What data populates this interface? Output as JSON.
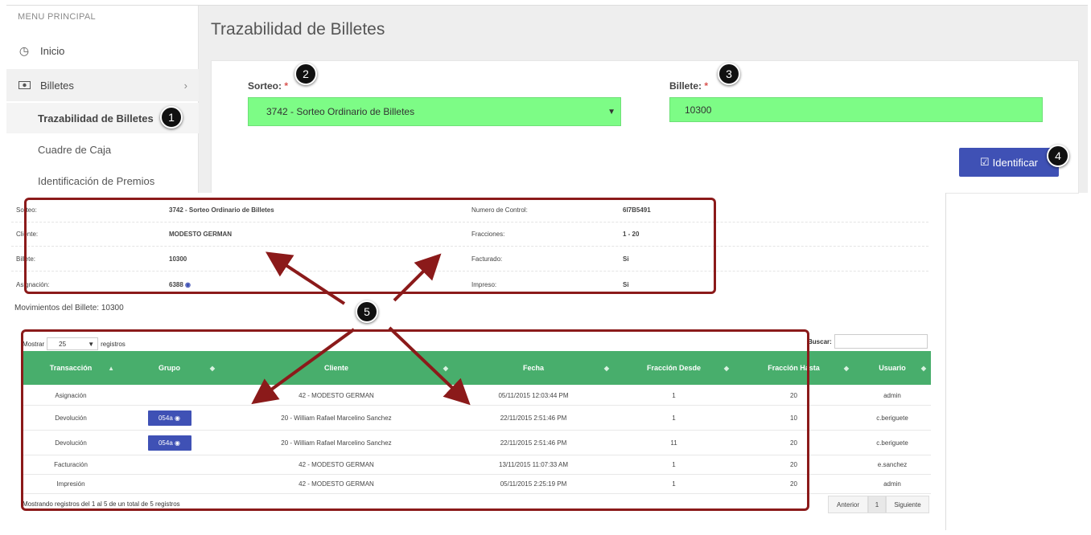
{
  "sidebar": {
    "menu_title": "MENU PRINCIPAL",
    "items": [
      {
        "label": "Inicio",
        "icon": "clock-icon"
      },
      {
        "label": "Billetes",
        "icon": "money-icon"
      }
    ],
    "subitems": [
      {
        "label": "Trazabilidad de Billetes",
        "active": true
      },
      {
        "label": "Cuadre de Caja"
      },
      {
        "label": "Identificación de Premios"
      }
    ]
  },
  "page": {
    "title": "Trazabilidad de Billetes"
  },
  "form": {
    "sorteo_label": "Sorteo:",
    "sorteo_value": "3742 - Sorteo Ordinario de Billetes",
    "billete_label": "Billete:",
    "billete_value": "10300",
    "required_mark": "*",
    "identify_button": "Identificar",
    "field_color": "#7dfc86",
    "button_color": "#3f51b5"
  },
  "callouts": [
    "1",
    "2",
    "3",
    "4",
    "5"
  ],
  "info": {
    "rows": [
      {
        "k1": "Sorteo:",
        "v1": "3742 - Sorteo Ordinario de Billetes",
        "k2": "Numero de Control:",
        "v2": "6I7B5491"
      },
      {
        "k1": "Cliente:",
        "v1": "MODESTO GERMAN",
        "k2": "Fracciones:",
        "v2": "1 - 20"
      },
      {
        "k1": "Billete:",
        "v1": "10300",
        "k2": "Facturado:",
        "v2": "Si"
      },
      {
        "k1": "Asignación:",
        "v1": "6388",
        "k2": "Impreso:",
        "v2": "Si"
      }
    ]
  },
  "movements": {
    "title": "Movimientos del Billete: 10300",
    "show_label": "Mostrar",
    "show_value": "25",
    "records_label": "registros",
    "search_label": "Buscar:",
    "columns": [
      "Transacción",
      "Grupo",
      "Cliente",
      "Fecha",
      "Fracción Desde",
      "Fracción Hasta",
      "Usuario"
    ],
    "rows": [
      {
        "tx": "Asignación",
        "group": "",
        "client": "42 - MODESTO GERMAN",
        "date": "05/11/2015 12:03:44 PM",
        "from": "1",
        "to": "20",
        "user": "admin"
      },
      {
        "tx": "Devolución",
        "group": "054a",
        "client": "20 - William Rafael Marcelino Sanchez",
        "date": "22/11/2015 2:51:46 PM",
        "from": "1",
        "to": "10",
        "user": "c.beriguete"
      },
      {
        "tx": "Devolución",
        "group": "054a",
        "client": "20 - William Rafael Marcelino Sanchez",
        "date": "22/11/2015 2:51:46 PM",
        "from": "11",
        "to": "20",
        "user": "c.beriguete"
      },
      {
        "tx": "Facturación",
        "group": "",
        "client": "42 - MODESTO GERMAN",
        "date": "13/11/2015 11:07:33 AM",
        "from": "1",
        "to": "20",
        "user": "e.sanchez"
      },
      {
        "tx": "Impresión",
        "group": "",
        "client": "42 - MODESTO GERMAN",
        "date": "05/11/2015 2:25:19 PM",
        "from": "1",
        "to": "20",
        "user": "admin"
      }
    ],
    "footer_info": "Mostrando registros del 1 al 5 de un total de 5 registros",
    "pager": {
      "prev": "Anterior",
      "page": "1",
      "next": "Siguiente"
    },
    "header_color": "#48ae6c"
  }
}
